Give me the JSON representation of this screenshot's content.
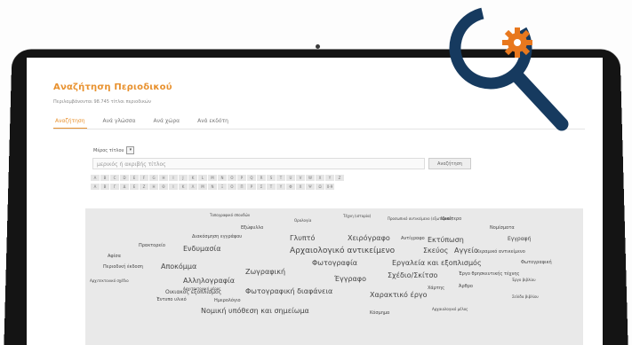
{
  "header": {
    "title": "Αναζήτηση Περιοδικού",
    "subtitle": "Περιλαμβάνονται 98.745 τίτλοι περιοδικών"
  },
  "tabs": [
    {
      "label": "Αναζήτηση",
      "active": true
    },
    {
      "label": "Ανά γλώσσα",
      "active": false
    },
    {
      "label": "Ανά χώρα",
      "active": false
    },
    {
      "label": "Ανά εκδότη",
      "active": false
    }
  ],
  "search": {
    "select_label": "Μέρος τίτλου",
    "placeholder": "μερικός ή ακριβής τίτλος",
    "button_label": "Αναζήτηση"
  },
  "alphabet": {
    "latin": [
      "A",
      "B",
      "C",
      "D",
      "E",
      "F",
      "G",
      "H",
      "I",
      "J",
      "K",
      "L",
      "M",
      "N",
      "O",
      "P",
      "Q",
      "R",
      "S",
      "T",
      "U",
      "V",
      "W",
      "X",
      "Y",
      "Z"
    ],
    "greek": [
      "Α",
      "Β",
      "Γ",
      "Δ",
      "Ε",
      "Ζ",
      "Η",
      "Θ",
      "Ι",
      "Κ",
      "Λ",
      "Μ",
      "Ν",
      "Ξ",
      "Ο",
      "Π",
      "Ρ",
      "Σ",
      "Τ",
      "Υ",
      "Φ",
      "Χ",
      "Ψ",
      "Ω",
      "0-9"
    ]
  },
  "tag_cloud": [
    {
      "text": "Τοπογραφικό σπουδών",
      "size": 4
    },
    {
      "text": "Ορολογία",
      "size": 4
    },
    {
      "text": "Τέχνη (ιστορία)",
      "size": 4
    },
    {
      "text": "Προσωπικό αντικείμενο (εξωτερικό)",
      "size": 4
    },
    {
      "text": "Εξώφυλλο",
      "size": 5
    },
    {
      "text": "Νομίσματα",
      "size": 5
    },
    {
      "text": "Διακόσμηση εγγράφου",
      "size": 5
    },
    {
      "text": "Γλυπτό",
      "size": 8
    },
    {
      "text": "Ιδιαίτερο",
      "size": 5
    },
    {
      "text": "Χειρόγραφο",
      "size": 8
    },
    {
      "text": "Αντίγραφο",
      "size": 5
    },
    {
      "text": "Εκτύπωση",
      "size": 8
    },
    {
      "text": "Εγγραφή",
      "size": 6
    },
    {
      "text": "Πρακτορείο",
      "size": 5
    },
    {
      "text": "Ενδυμασία",
      "size": 8
    },
    {
      "text": "Αρχαιολογικό αντικείμενο",
      "size": 9
    },
    {
      "text": "Σκεύος",
      "size": 8
    },
    {
      "text": "Αγγείο",
      "size": 8
    },
    {
      "text": "Κεραμικό αντικείμενο",
      "size": 5
    },
    {
      "text": "Αφίσα",
      "size": 5
    },
    {
      "text": "Φωτογραφία",
      "size": 8
    },
    {
      "text": "Εργαλεία και εξοπλισμός",
      "size": 8
    },
    {
      "text": "Φωτογραφική",
      "size": 5
    },
    {
      "text": "Περιοδική έκδοση",
      "size": 5
    },
    {
      "text": "Αποκόμμα",
      "size": 8
    },
    {
      "text": "Ζωγραφική",
      "size": 8
    },
    {
      "text": "Αρχιτεκτονικό σχέδιο",
      "size": 4
    },
    {
      "text": "Αλληλογραφία",
      "size": 8
    },
    {
      "text": "Έγγραφο",
      "size": 8
    },
    {
      "text": "Σχέδιο/Σκίτσο",
      "size": 8
    },
    {
      "text": "Έργο θρησκευτικής τέχνης",
      "size": 5
    },
    {
      "text": "Αρχιτεκτονική μέρος",
      "size": 4
    },
    {
      "text": "Οικιακός εξοπλισμός",
      "size": 6
    },
    {
      "text": "Φωτογραφική διαφάνεια",
      "size": 8
    },
    {
      "text": "Χάρτης",
      "size": 5
    },
    {
      "text": "Άρθρο",
      "size": 5
    },
    {
      "text": "Έργο βιβλίου",
      "size": 4
    },
    {
      "text": "Έντυπο υλικό",
      "size": 5
    },
    {
      "text": "Ημερολόγιο",
      "size": 5
    },
    {
      "text": "Χαρακτικό έργο",
      "size": 8
    },
    {
      "text": "Σελίδα βιβλίου",
      "size": 4
    },
    {
      "text": "Νομική υπόθεση και σημείωμα",
      "size": 8
    },
    {
      "text": "Κόσμημα",
      "size": 5
    },
    {
      "text": "Αρχαιολογικό μέλος",
      "size": 4
    }
  ],
  "colors": {
    "accent": "#e8912e",
    "logo_dark": "#163a5f",
    "logo_orange": "#e8781e"
  },
  "icons": {
    "logo": "magnifier-gear-icon"
  }
}
